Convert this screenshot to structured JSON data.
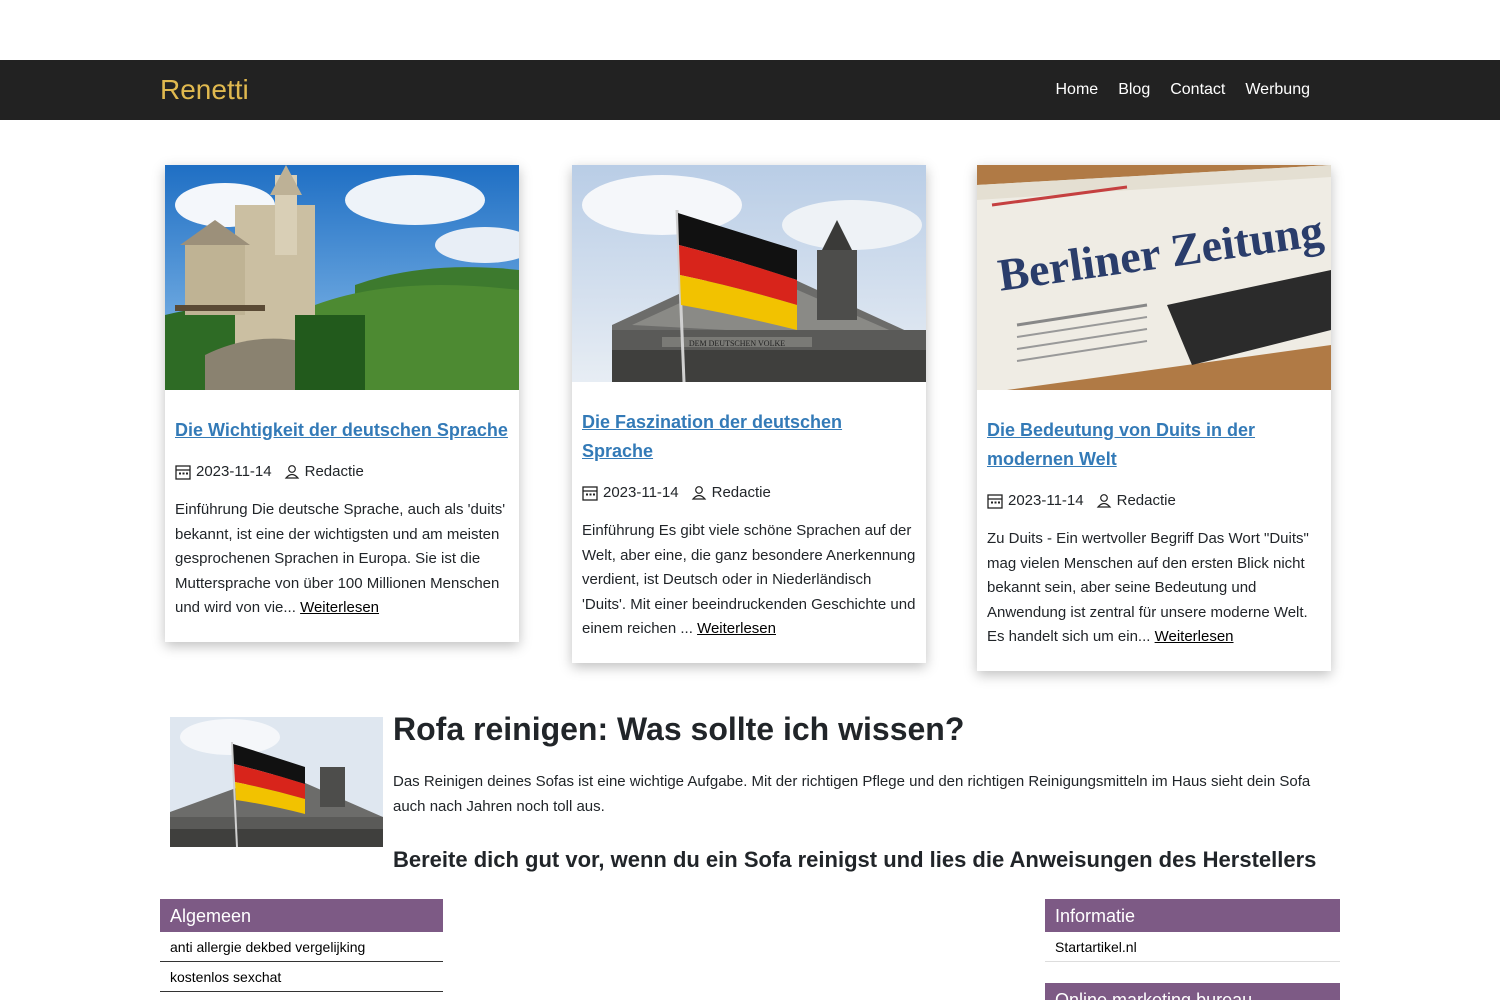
{
  "header": {
    "brand": "Renetti",
    "nav": [
      "Home",
      "Blog",
      "Contact",
      "Werbung"
    ]
  },
  "posts": [
    {
      "title": "Die Wichtigkeit der deutschen Sprache",
      "date": "2023-11-14",
      "author": "Redactie",
      "excerpt": "Einführung Die deutsche Sprache, auch als 'duits' bekannt, ist eine der wichtigsten und am meisten gesprochenen Sprachen in Europa. Sie ist die Muttersprache von über 100 Millionen Menschen und wird von vie...",
      "read_more": "Weiterlesen",
      "image": "castle-landscape-photo"
    },
    {
      "title": "Die Faszination der deutschen Sprache",
      "date": "2023-11-14",
      "author": "Redactie",
      "excerpt": "Einführung Es gibt viele schöne Sprachen auf der Welt, aber eine, die ganz besondere Anerkennung verdient, ist Deutsch oder in Niederländisch 'Duits'. Mit einer beeindruckenden Geschichte und einem reichen ...",
      "read_more": "Weiterlesen",
      "image": "german-flag-reichstag-photo",
      "photo_inscription": "DEM DEUTSCHEN VOLKE"
    },
    {
      "title": "Die Bedeutung von Duits in der modernen Welt",
      "date": "2023-11-14",
      "author": "Redactie",
      "excerpt": "Zu Duits - Ein wertvoller Begriff Das Wort \"Duits\" mag vielen Menschen auf den ersten Blick nicht bekannt sein, aber seine Bedeutung und Anwendung ist zentral für unsere moderne Welt. Es handelt sich um ein...",
      "read_more": "Weiterlesen",
      "image": "newspaper-photo",
      "photo_inscription": "Berliner Zeitung"
    }
  ],
  "feature": {
    "title": "Rofa reinigen: Was sollte ich wissen?",
    "text": "Das Reinigen deines Sofas ist eine wichtige Aufgabe. Mit der richtigen Pflege und den richtigen Reinigungsmitteln im Haus sieht dein Sofa auch nach Jahren noch toll aus.",
    "subheading": "Bereite dich gut vor, wenn du ein Sofa reinigst und lies die Anweisungen des Herstellers",
    "image": "german-flag-reichstag-photo"
  },
  "sidebar_left": {
    "title": "Algemeen",
    "items": [
      "anti allergie dekbed vergelijking",
      "kostenlos sexchat"
    ]
  },
  "sidebar_right": {
    "title": "Informatie",
    "items": [
      "Startartikel.nl"
    ]
  },
  "sidebar_right_2": {
    "title": "Online marketing bureau"
  },
  "colors": {
    "topbar": "#222222",
    "brand": "#e0b94f",
    "link": "#337ab7",
    "widget_header": "#7d5a85"
  }
}
